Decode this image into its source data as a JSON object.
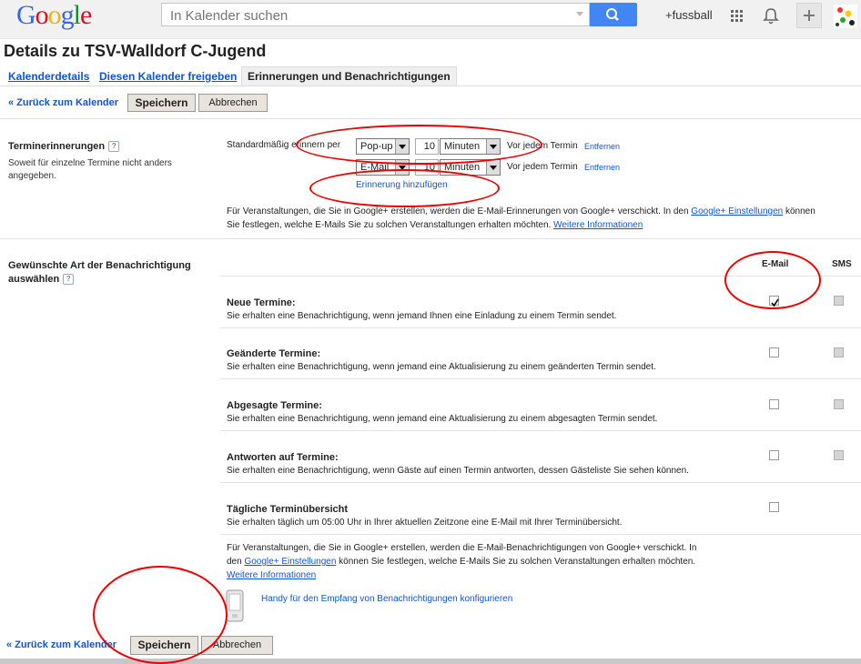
{
  "header": {
    "logo_letters": [
      {
        "ch": "G",
        "color": "#3369e8"
      },
      {
        "ch": "o",
        "color": "#d50f25"
      },
      {
        "ch": "o",
        "color": "#eeb211"
      },
      {
        "ch": "g",
        "color": "#3369e8"
      },
      {
        "ch": "l",
        "color": "#009925"
      },
      {
        "ch": "e",
        "color": "#d50f25"
      }
    ],
    "search_placeholder": "In Kalender suchen",
    "user_label": "+fussball"
  },
  "page_title": "Details zu TSV-Walldorf C-Jugend",
  "tabs": [
    {
      "label": "Kalenderdetails",
      "active": false
    },
    {
      "label": "Diesen Kalender freigeben",
      "active": false
    },
    {
      "label": "Erinnerungen und Benachrichtigungen",
      "active": true
    }
  ],
  "toolbar": {
    "back_label": "« Zurück zum Kalender",
    "save_label": "Speichern",
    "cancel_label": "Abbrechen"
  },
  "reminders": {
    "title": "Terminerinnerungen",
    "desc": "Soweit für einzelne Termine nicht anders angegeben.",
    "default_label": "Standardmäßig erinnern per",
    "rows": [
      {
        "method": "Pop-up",
        "amount": "10",
        "unit": "Minuten",
        "suffix": "Vor jedem Termin",
        "remove": "Entfernen"
      },
      {
        "method": "E-Mail",
        "amount": "10",
        "unit": "Minuten",
        "suffix": "Vor jedem Termin",
        "remove": "Entfernen"
      }
    ],
    "add_label": "Erinnerung hinzufügen",
    "note_a": "Für Veranstaltungen, die Sie in Google+ erstellen, werden die E-Mail-Erinnerungen von Google+ verschickt. In den ",
    "note_link1": "Google+ Einstellungen",
    "note_b": " können",
    "note_c": "Sie festlegen, welche E-Mails Sie zu solchen Veranstaltungen erhalten möchten. ",
    "note_link2": "Weitere Informationen"
  },
  "notifications": {
    "title": "Gewünschte Art der Benachrichtigung auswählen",
    "col_email": "E-Mail",
    "col_sms": "SMS",
    "items": [
      {
        "title": "Neue Termine:",
        "desc": "Sie erhalten eine Benachrichtigung, wenn jemand Ihnen eine Einladung zu einem Termin sendet.",
        "email": true,
        "sms": "disabled"
      },
      {
        "title": "Geänderte Termine:",
        "desc": "Sie erhalten eine Benachrichtigung, wenn jemand eine Aktualisierung zu einem geänderten Termin sendet.",
        "email": false,
        "sms": "disabled"
      },
      {
        "title": "Abgesagte Termine:",
        "desc": "Sie erhalten eine Benachrichtigung, wenn jemand eine Aktualisierung zu einem abgesagten Termin sendet.",
        "email": false,
        "sms": "disabled"
      },
      {
        "title": "Antworten auf Termine:",
        "desc": "Sie erhalten eine Benachrichtigung, wenn Gäste auf einen Termin antworten, dessen Gästeliste Sie sehen können.",
        "email": false,
        "sms": "disabled"
      },
      {
        "title": "Tägliche Terminübersicht",
        "desc": "Sie erhalten täglich um 05:00 Uhr in Ihrer aktuellen Zeitzone eine E-Mail mit Ihrer Terminübersicht.",
        "email": false,
        "sms": "none"
      }
    ],
    "note_a": "Für Veranstaltungen, die Sie in Google+ erstellen, werden die E-Mail-Benachrichtigungen von Google+ verschickt. In",
    "note_b": "den ",
    "note_link1": "Google+ Einstellungen",
    "note_c": " können Sie festlegen, welche E-Mails Sie zu solchen Veranstaltungen erhalten möchten.",
    "note_link2": "Weitere Informationen",
    "mobile_label": "Handy für den Empfang von Benachrichtigungen konfigurieren"
  },
  "colors": {
    "link": "#1155cc",
    "highlight": "#e00000",
    "search_button": "#4285f4"
  }
}
